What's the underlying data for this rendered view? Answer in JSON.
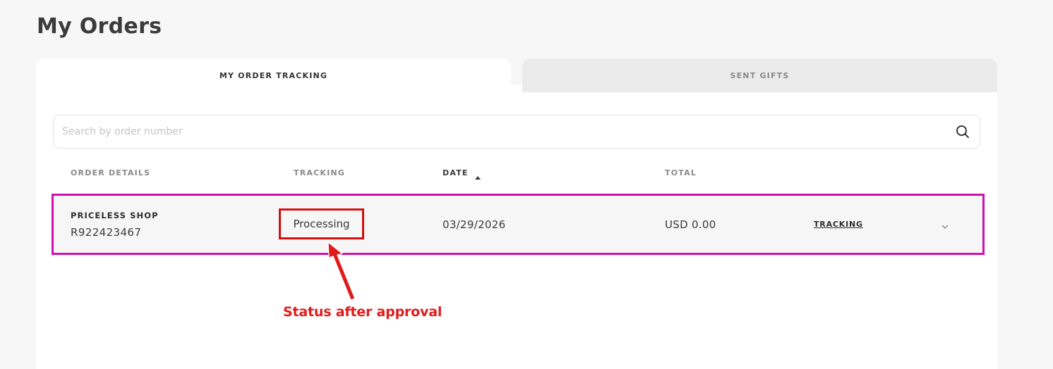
{
  "page": {
    "title": "My Orders"
  },
  "tabs": [
    {
      "label": "MY ORDER TRACKING",
      "active": true
    },
    {
      "label": "SENT GIFTS",
      "active": false
    }
  ],
  "search": {
    "placeholder": "Search by order number",
    "value": ""
  },
  "table": {
    "headers": {
      "order_details": "ORDER DETAILS",
      "tracking": "TRACKING",
      "date": "DATE",
      "total": "TOTAL"
    },
    "sort": {
      "column": "date",
      "direction": "ascending"
    },
    "rows": [
      {
        "shop": "PRICELESS SHOP",
        "order_number": "R922423467",
        "status": "Processing",
        "date": "03/29/2026",
        "total": "USD 0.00",
        "tracking_link": "TRACKING"
      }
    ]
  },
  "annotation": {
    "text": "Status after approval",
    "color": "#e01b1b",
    "row_highlight_color": "#d10fb3",
    "status_highlight_color": "#d50f0f"
  },
  "icons": {
    "search": "search-icon",
    "sort": "sort-ascending-icon",
    "expand": "chevron-down-icon"
  }
}
